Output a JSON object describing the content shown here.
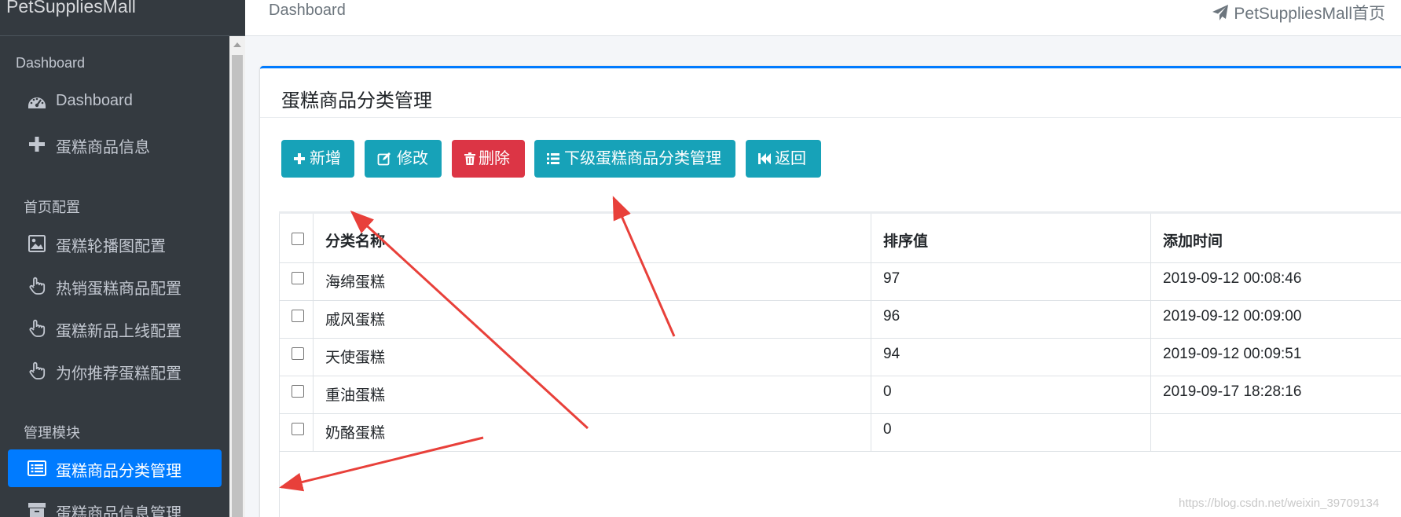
{
  "brand": "PetSuppliesMall",
  "topbar": {
    "breadcrumb": "Dashboard",
    "home_link": "PetSuppliesMall首页"
  },
  "sidebar": {
    "sections": [
      {
        "header": "Dashboard",
        "items": [
          {
            "label": "Dashboard",
            "icon": "tachometer-icon"
          },
          {
            "label": "蛋糕商品信息",
            "icon": "plus-icon"
          }
        ]
      },
      {
        "header": "首页配置",
        "items": [
          {
            "label": "蛋糕轮播图配置",
            "icon": "image-icon"
          },
          {
            "label": "热销蛋糕商品配置",
            "icon": "hand-pointer-icon"
          },
          {
            "label": "蛋糕新品上线配置",
            "icon": "hand-pointer-icon"
          },
          {
            "label": "为你推荐蛋糕配置",
            "icon": "hand-pointer-icon"
          }
        ]
      },
      {
        "header": "管理模块",
        "items": [
          {
            "label": "蛋糕商品分类管理",
            "icon": "list-alt-icon",
            "active": true
          },
          {
            "label": "蛋糕商品信息管理",
            "icon": "archive-icon"
          }
        ]
      }
    ]
  },
  "card": {
    "title": "蛋糕商品分类管理",
    "buttons": {
      "add": "新增",
      "edit": "修改",
      "delete": "删除",
      "sub_category": "下级蛋糕商品分类管理",
      "back": "返回"
    }
  },
  "table": {
    "columns": [
      "分类名称",
      "排序值",
      "添加时间"
    ],
    "rows": [
      {
        "name": "海绵蛋糕",
        "rank": "97",
        "time": "2019-09-12 00:08:46"
      },
      {
        "name": "戚风蛋糕",
        "rank": "96",
        "time": "2019-09-12 00:09:00"
      },
      {
        "name": "天使蛋糕",
        "rank": "94",
        "time": "2019-09-12 00:09:51"
      },
      {
        "name": "重油蛋糕",
        "rank": "0",
        "time": "2019-09-17 18:28:16"
      },
      {
        "name": "奶酪蛋糕",
        "rank": "0",
        "time": ""
      }
    ]
  },
  "watermark": "https://blog.csdn.net/weixin_39709134",
  "colors": {
    "sidebar_bg": "#343a40",
    "active": "#007bff",
    "info": "#17a2b8",
    "danger": "#dc3545",
    "annotation_arrow": "#e8403a"
  }
}
